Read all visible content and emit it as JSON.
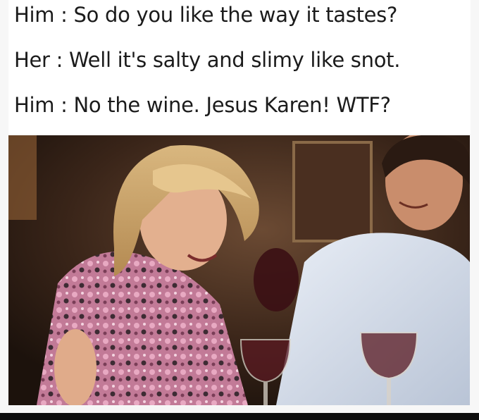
{
  "caption": {
    "lines": [
      "Him : So do you like the way it tastes?",
      "Her : Well it's salty and slimy like snot.",
      "Him : No the wine. Jesus Karen! WTF?"
    ]
  },
  "photo": {
    "subject": "woman-and-man-at-restaurant-table-with-wine-glasses"
  },
  "colors": {
    "caption_text": "#1b1b1b",
    "caption_background": "#ffffff",
    "photo_background": "#2a1d16"
  }
}
